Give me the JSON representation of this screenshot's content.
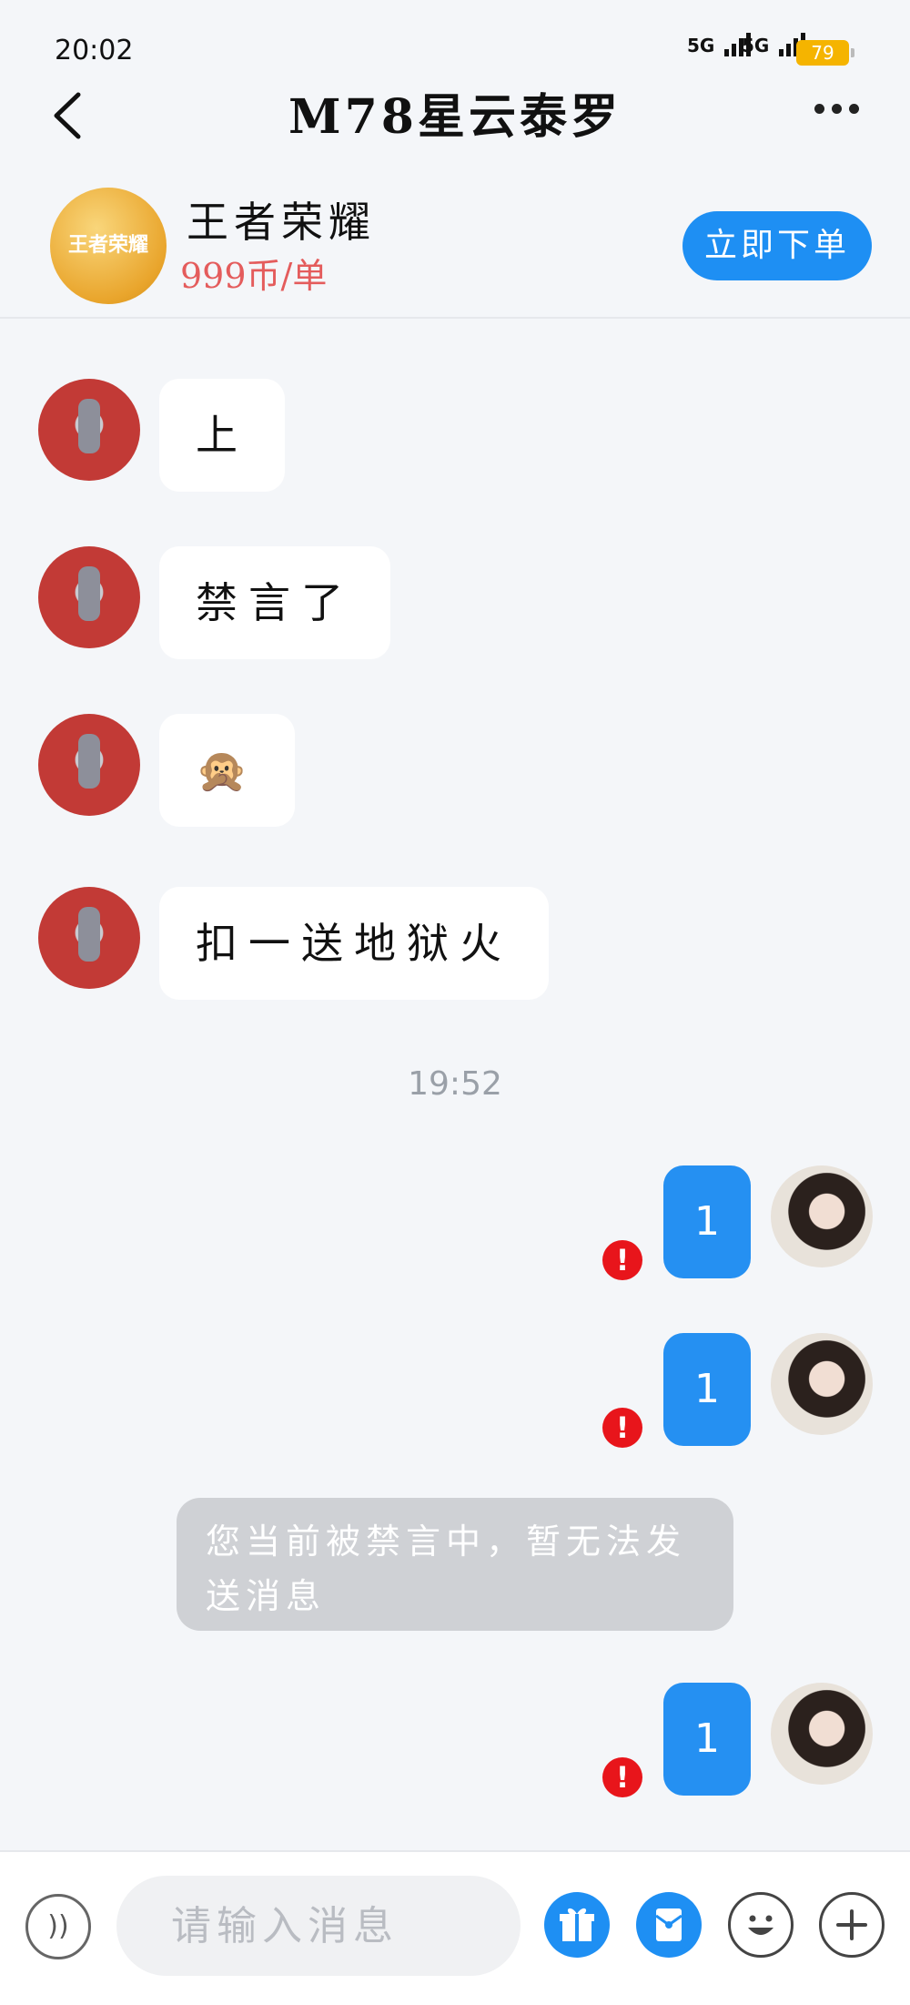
{
  "status_bar": {
    "time": "20:02",
    "network_1": "5G",
    "network_2": "5G",
    "battery": "79"
  },
  "header": {
    "title": "M78星云泰罗"
  },
  "product": {
    "logo_text": "王者荣耀",
    "name": "王者荣耀",
    "price": "999币/单",
    "order_button": "立即下单"
  },
  "messages_in": [
    {
      "text": "上"
    },
    {
      "text": "禁言了"
    },
    {
      "text": "🙊"
    },
    {
      "text": "扣一送地狱火"
    }
  ],
  "timestamp": "19:52",
  "messages_out": [
    {
      "text": "1",
      "status": "!"
    },
    {
      "text": "1",
      "status": "!"
    },
    {
      "text": "1",
      "status": "!"
    }
  ],
  "system_notice": "您当前被禁言中，暂无法发送消息",
  "input_bar": {
    "placeholder": "请输入消息"
  },
  "icons": {
    "back": "chevron-left-icon",
    "more": "ellipsis-icon",
    "voice": "voice-icon",
    "gift": "gift-icon",
    "red_packet": "red-packet-icon",
    "emoji": "emoji-icon",
    "plus": "plus-icon"
  },
  "colors": {
    "accent": "#1e8ff3",
    "price": "#e45c5c",
    "error": "#e8151b",
    "battery": "#f5b400"
  }
}
